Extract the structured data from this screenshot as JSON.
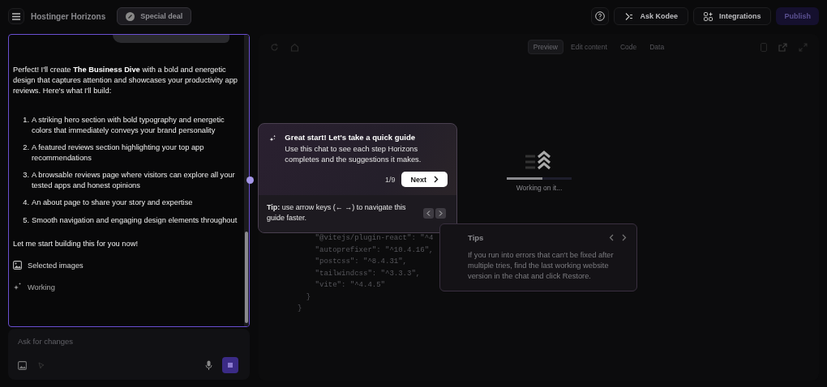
{
  "header": {
    "brand": "Hostinger Horizons",
    "deal": "Special deal",
    "actions": [
      {
        "label": "Ask Kodee",
        "kind": "kodee"
      },
      {
        "label": "Integrations",
        "kind": "integrations"
      }
    ],
    "publish": "Publish"
  },
  "chat": {
    "intro": "Perfect! I'll create **The Business Dive** with a bold and energetic design that captures attention and showcases your productivity app reviews. Here's what I'll build:",
    "steps": [
      {
        "number": "1.",
        "text": "A striking hero section with bold typography and energetic colors that immediately conveys your brand personality"
      },
      {
        "number": "2.",
        "text": "A featured reviews section highlighting your top app recommendations"
      },
      {
        "number": "3.",
        "text": "A browsable reviews page where visitors can explore all your tested apps and honest opinions"
      },
      {
        "number": "4.",
        "text": "An about page to share your story and expertise"
      },
      {
        "number": "5.",
        "text": "Smooth navigation and engaging design elements throughout"
      }
    ],
    "outro": "Let me start building this for you now!",
    "attachment": "Selected images",
    "status": "Working"
  },
  "composer": {
    "placeholder": "Ask for changes"
  },
  "preview": {
    "tabs": [
      {
        "label": "Preview",
        "selected": true
      },
      {
        "label": "Edit content",
        "selected": false
      },
      {
        "label": "Code",
        "selected": false
      },
      {
        "label": "Data",
        "selected": false
      }
    ],
    "code_lines": [
      "    \"@vitejs/plugin-react\": \"^4",
      "    \"autoprefixer\": \"^10.4.16\",",
      "    \"postcss\": \"^8.4.31\",",
      "    \"tailwindcss\": \"^3.3.3\",",
      "    \"vite\": \"^4.4.5\"",
      "  }",
      "}"
    ],
    "loading": {
      "text": "Working on it...",
      "level": 0.55
    }
  },
  "guide": {
    "title": "Great start! Let's take a quick guide",
    "body": "Use this chat to see each step Horizons completes and the suggestions it makes.",
    "counter": "1/9",
    "next": "Next",
    "tip": "**Tip:** use arrow keys (← →) to navigate this guide faster."
  },
  "tips": {
    "title": "Tips",
    "body": "If you run into errors that can't be fixed after multiple tries, find the last working website version in the chat and click Restore."
  }
}
